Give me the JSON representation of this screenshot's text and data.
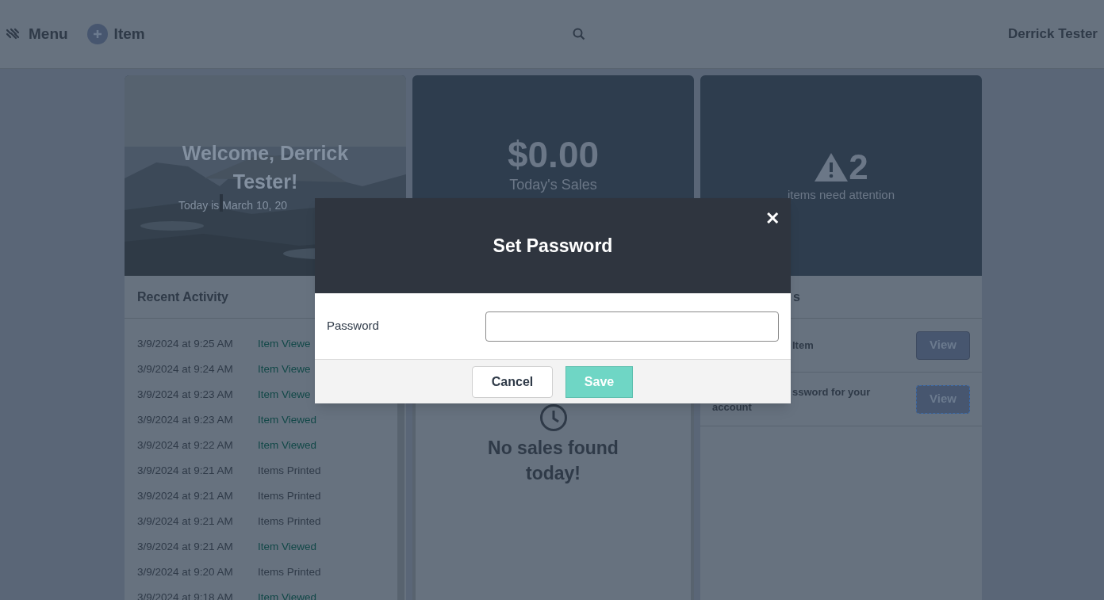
{
  "header": {
    "menu_label": "Menu",
    "add_label": "Item",
    "user": "Derrick Tester"
  },
  "welcome": {
    "title": "Welcome, Derrick Tester!",
    "date": "Today is March 10, 20"
  },
  "sales": {
    "amount": "$0.00",
    "label": "Today's Sales",
    "empty": "No sales found today!"
  },
  "attention": {
    "count": "2",
    "label": "items need attention",
    "title": "s"
  },
  "recent_activity": {
    "title": "Recent Activity",
    "rows": [
      {
        "time": "3/9/2024 at 9:25 AM",
        "event": "Item Viewe",
        "kind": "view"
      },
      {
        "time": "3/9/2024 at 9:24 AM",
        "event": "Item Viewe",
        "kind": "view"
      },
      {
        "time": "3/9/2024 at 9:23 AM",
        "event": "Item Viewe",
        "kind": "view"
      },
      {
        "time": "3/9/2024 at 9:23 AM",
        "event": "Item Viewed",
        "kind": "view"
      },
      {
        "time": "3/9/2024 at 9:22 AM",
        "event": "Item Viewed",
        "kind": "view"
      },
      {
        "time": "3/9/2024 at 9:21 AM",
        "event": "Items Printed",
        "kind": "print"
      },
      {
        "time": "3/9/2024 at 9:21 AM",
        "event": "Items Printed",
        "kind": "print"
      },
      {
        "time": "3/9/2024 at 9:21 AM",
        "event": "Items Printed",
        "kind": "print"
      },
      {
        "time": "3/9/2024 at 9:21 AM",
        "event": "Item Viewed",
        "kind": "view"
      },
      {
        "time": "3/9/2024 at 9:20 AM",
        "event": "Items Printed",
        "kind": "print"
      },
      {
        "time": "3/9/2024 at 9:18 AM",
        "event": "Item Viewed",
        "kind": "view"
      }
    ]
  },
  "tasks": [
    {
      "lines": [
        "Item"
      ],
      "button": "View",
      "focused": false
    },
    {
      "lines": [
        "ssword for your",
        "account"
      ],
      "button": "View",
      "focused": true
    }
  ],
  "modal": {
    "title": "Set Password",
    "close": "✕",
    "field_label": "Password",
    "buttons": [
      {
        "label": "Cancel",
        "kind": "secondary"
      },
      {
        "label": "Save",
        "kind": "primary"
      }
    ]
  }
}
